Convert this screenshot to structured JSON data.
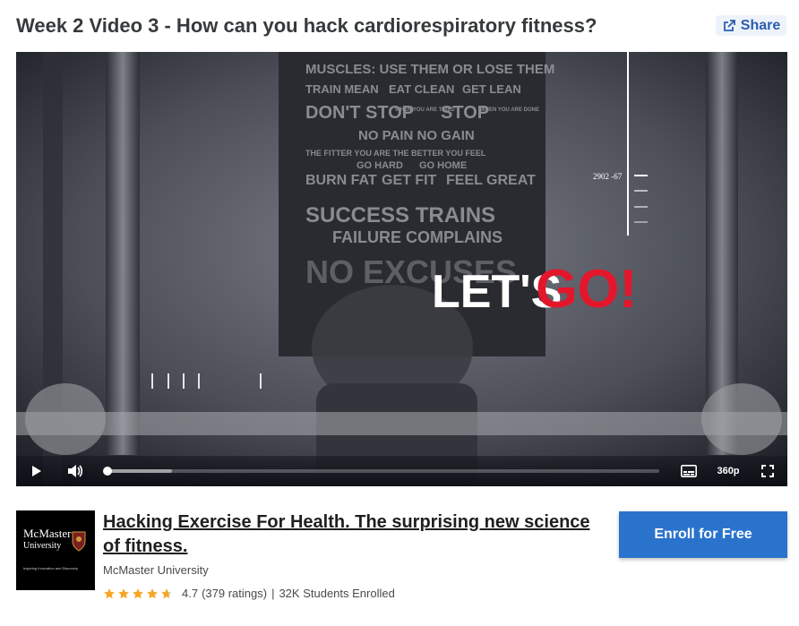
{
  "page": {
    "title": "Week 2 Video 3 - How can you hack cardiorespiratory fitness?",
    "share_label": "Share"
  },
  "video": {
    "poster_lines": [
      "MUSCLES: USE THEM OR LOSE THEM",
      "TRAIN MEAN",
      "EAT CLEAN",
      "GET LEAN",
      "DON'T STOP",
      "WHEN YOU ARE TIRED",
      "STOP",
      "WHEN YOU ARE DONE",
      "NO PAIN NO GAIN",
      "THE FITTER YOU ARE THE BETTER YOU FEEL",
      "GO HARD",
      "GO HOME",
      "BURN FAT",
      "GET FIT",
      "FEEL GREAT",
      "SUCCESS TRAINS",
      "FAILURE COMPLAINS",
      "NO EXCUSES"
    ],
    "overlay_white": "LET'S",
    "overlay_red": "GO!",
    "hud_reading": "2902 -67",
    "progress_played": 0.003,
    "progress_buffered": 0.12,
    "quality": "360p",
    "icons": {
      "play": "play-icon",
      "volume": "volume-icon",
      "captions": "captions-icon",
      "fullscreen": "fullscreen-icon"
    }
  },
  "course": {
    "logo_line1": "McMaster",
    "logo_line2": "University",
    "logo_tagline": "Inspiring Innovation and Discovery",
    "title": "Hacking Exercise For Health. The surprising new science of fitness.",
    "partner": "McMaster University",
    "rating": "4.7",
    "ratings_count": "(379 ratings)",
    "separator": "|",
    "enrolled": "32K Students Enrolled",
    "stars_value": 4.7,
    "enroll_label": "Enroll for Free"
  },
  "colors": {
    "accent": "#2a73cc",
    "share_text": "#2a5db0",
    "star": "#f5a623",
    "overlay_red": "#e4162c"
  }
}
